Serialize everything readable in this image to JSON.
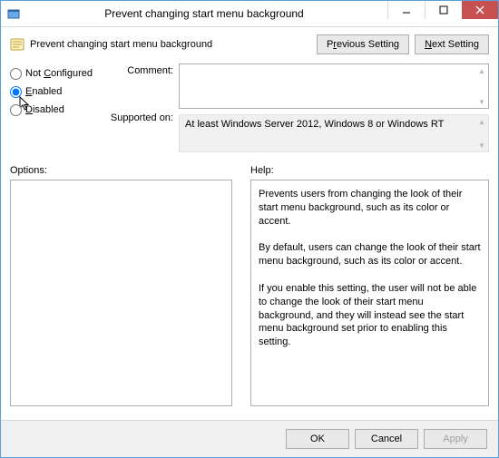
{
  "window": {
    "title": "Prevent changing start menu background"
  },
  "header": {
    "policy_title": "Prevent changing start menu background",
    "previous_label_pre": "P",
    "previous_label_u": "r",
    "previous_label_post": "evious Setting",
    "next_label_u": "N",
    "next_label_post": "ext Setting"
  },
  "state": {
    "not_configured_label_pre": "Not ",
    "not_configured_label_u": "C",
    "not_configured_label_post": "onfigured",
    "enabled_label_u": "E",
    "enabled_label_post": "nabled",
    "disabled_label_u": "D",
    "disabled_label_post": "isabled",
    "selected": "enabled"
  },
  "labels": {
    "comment": "Comment:",
    "supported": "Supported on:",
    "options": "Options:",
    "help": "Help:"
  },
  "supported_text": "At least Windows Server 2012, Windows 8 or Windows RT",
  "help_text": "Prevents users from changing the look of their start menu background, such as its color or accent.\n\nBy default, users can change the look of their start menu background, such as its color or accent.\n\nIf you enable this setting, the user will not be able to change the look of their start menu background, and they will instead see the start menu background set prior to enabling this setting.",
  "footer": {
    "ok": "OK",
    "cancel": "Cancel",
    "apply": "Apply"
  }
}
